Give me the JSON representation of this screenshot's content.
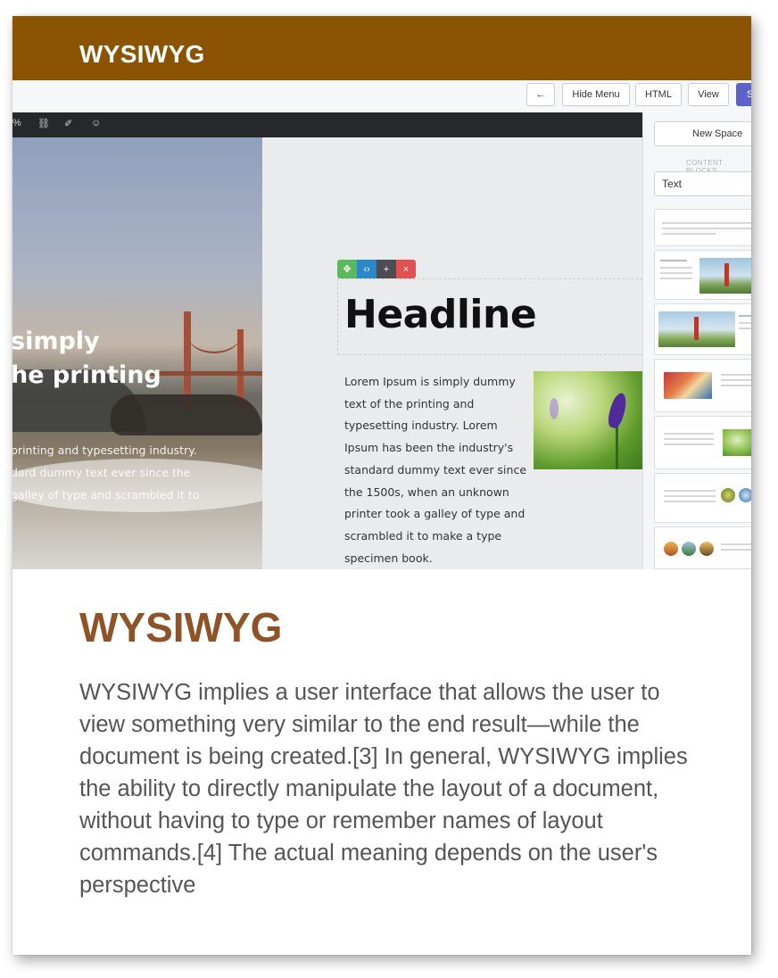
{
  "header": {
    "title": "WYSIWYG"
  },
  "toolbar": {
    "back_label": "←",
    "hide_menu_label": "Hide Menu",
    "html_label": "HTML",
    "view_label": "View",
    "save_label": "S"
  },
  "editor_bar": {
    "icons": [
      "link-icon",
      "unlink-icon",
      "eraser-icon",
      "emoji-icon"
    ],
    "glyphs": [
      "%",
      "⛓",
      "✐",
      "☺"
    ]
  },
  "hero": {
    "heading_lines": [
      "simply",
      "he printing"
    ],
    "text_lines": [
      "printing and typesetting industry.",
      "dard dummy text ever since the",
      "galley of type and scrambled it to"
    ]
  },
  "block": {
    "controls": [
      "✥",
      "‹›",
      "+",
      "×"
    ],
    "headline": "Headline",
    "lorem": "Lorem Ipsum is simply dummy text of the printing and typesetting industry. Lorem Ipsum has been the industry's standard dummy text ever since the 1500s, when an unknown printer took a galley of type and scrambled it to make a type specimen book."
  },
  "sidebar": {
    "new_space_label": "New Space",
    "content_blocks_label": "CONTENT BLOCKS",
    "select_value": "Text"
  },
  "article": {
    "title": "WYSIWYG",
    "body": "WYSIWYG implies a user interface that allows the user to view something very similar to the end result—while the document is being created.[3] In general, WYSIWYG implies the ability to directly manipulate the layout of a document, without having to type or remember names of layout commands.[4] The actual meaning depends on the user's perspective"
  },
  "colors": {
    "header_bg": "#8b5404",
    "title_color": "#8e5428",
    "body_text": "#555555",
    "save_button": "#5b62c9"
  }
}
